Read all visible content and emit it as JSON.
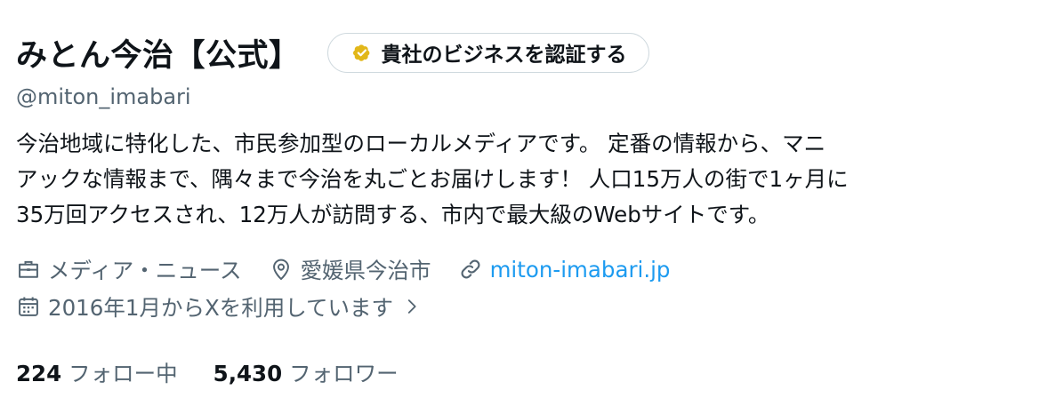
{
  "profile": {
    "display_name": "みとん今治【公式】",
    "verify_button_label": "貴社のビジネスを認証する",
    "handle": "@miton_imabari",
    "bio_lines": [
      "今治地域に特化した、市民参加型のローカルメディアです。 定番の情報から、マニ",
      "アックな情報まで、隅々まで今治を丸ごとお届けします！ 人口15万人の街で1ヶ月に",
      "35万回アクセスされ、12万人が訪問する、市内で最大級のWebサイトです。"
    ],
    "category": "メディア・ニュース",
    "location": "愛媛県今治市",
    "website": "miton-imabari.jp",
    "joined": "2016年1月からXを利用しています",
    "following_count": "224",
    "following_label": "フォロー中",
    "followers_count": "5,430",
    "followers_label": "フォロワー"
  },
  "icons": {
    "verify_badge": "gold-verified-badge-icon",
    "category": "briefcase-icon",
    "location": "location-pin-icon",
    "website": "link-icon",
    "joined": "calendar-icon",
    "joined_more": "chevron-right-icon"
  },
  "colors": {
    "text_primary": "#0f1419",
    "text_secondary": "#536471",
    "link": "#1d9bf0",
    "badge_gold": "#e2b719",
    "border": "#cfd9de"
  }
}
